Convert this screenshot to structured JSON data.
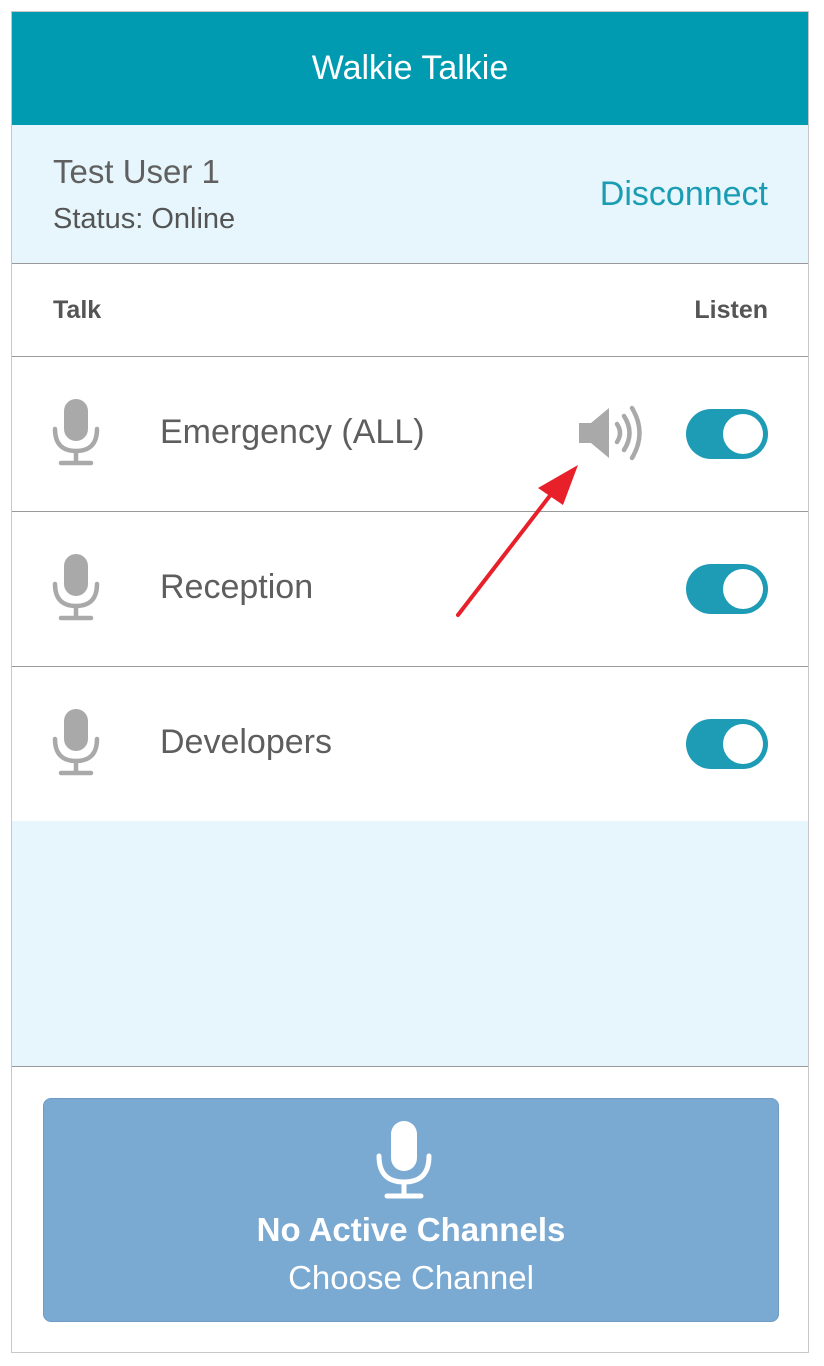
{
  "app": {
    "title": "Walkie Talkie"
  },
  "user": {
    "name": "Test User 1",
    "status": "Status: Online",
    "disconnect_label": "Disconnect"
  },
  "columns": {
    "talk": "Talk",
    "listen": "Listen"
  },
  "channels": [
    {
      "label": "Emergency (ALL)",
      "talk_icon": "microphone-icon",
      "speaker_active": true,
      "listen_on": true
    },
    {
      "label": "Reception",
      "talk_icon": "microphone-icon",
      "speaker_active": false,
      "listen_on": true
    },
    {
      "label": "Developers",
      "talk_icon": "microphone-icon",
      "speaker_active": false,
      "listen_on": true
    }
  ],
  "talk_button": {
    "icon": "microphone-icon",
    "title": "No Active Channels",
    "subtitle": "Choose Channel"
  },
  "colors": {
    "header": "#009bb1",
    "accent": "#1f9cb5",
    "panel": "#e6f6fc",
    "talk_button": "#7aa9d2",
    "annotation_arrow": "#e8202a"
  }
}
